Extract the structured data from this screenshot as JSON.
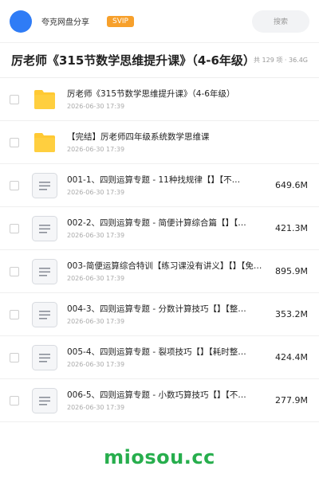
{
  "topbar": {
    "share_title": "夸克网盘分享",
    "svip_label": "SVIP",
    "search_placeholder": "搜索"
  },
  "header": {
    "title": "厉老师《315节数学思维提升课》（4-6年级）",
    "meta": "共 129 项 · 36.4G"
  },
  "files": [
    {
      "type": "folder",
      "name": "厉老师《315节数学思维提升课》（4-6年级）",
      "date": "2026-06-30 17:39",
      "size": ""
    },
    {
      "type": "folder",
      "name": "【完结】厉老师四年级系统数学思维课",
      "date": "2026-06-30 17:39",
      "size": ""
    },
    {
      "type": "file",
      "name": "001-1、四则运算专题 - 11种找规律【】【不…",
      "date": "2026-06-30 17:39",
      "size": "649.6M"
    },
    {
      "type": "file",
      "name": "002-2、四则运算专题 - 简便计算综合篇【】【…",
      "date": "2026-06-30 17:39",
      "size": "421.3M"
    },
    {
      "type": "file",
      "name": "003-简便运算综合特训【练习课没有讲义】【】【免…",
      "date": "2026-06-30 17:39",
      "size": "895.9M"
    },
    {
      "type": "file",
      "name": "004-3、四则运算专题 - 分数计算技巧【】【整…",
      "date": "2026-06-30 17:39",
      "size": "353.2M"
    },
    {
      "type": "file",
      "name": "005-4、四则运算专题 - 裂项技巧【】【耗时整…",
      "date": "2026-06-30 17:39",
      "size": "424.4M"
    },
    {
      "type": "file",
      "name": "006-5、四则运算专题 - 小数巧算技巧【】【不…",
      "date": "2026-06-30 17:39",
      "size": "277.9M"
    }
  ],
  "icons": {
    "folder": "folder-icon",
    "file": "document-icon"
  },
  "colors": {
    "accent": "#2f7cf6",
    "svip": "#f7a02b",
    "folder": "#ffc933",
    "watermark": "#27ae4d"
  },
  "watermark": "miosou.cc"
}
